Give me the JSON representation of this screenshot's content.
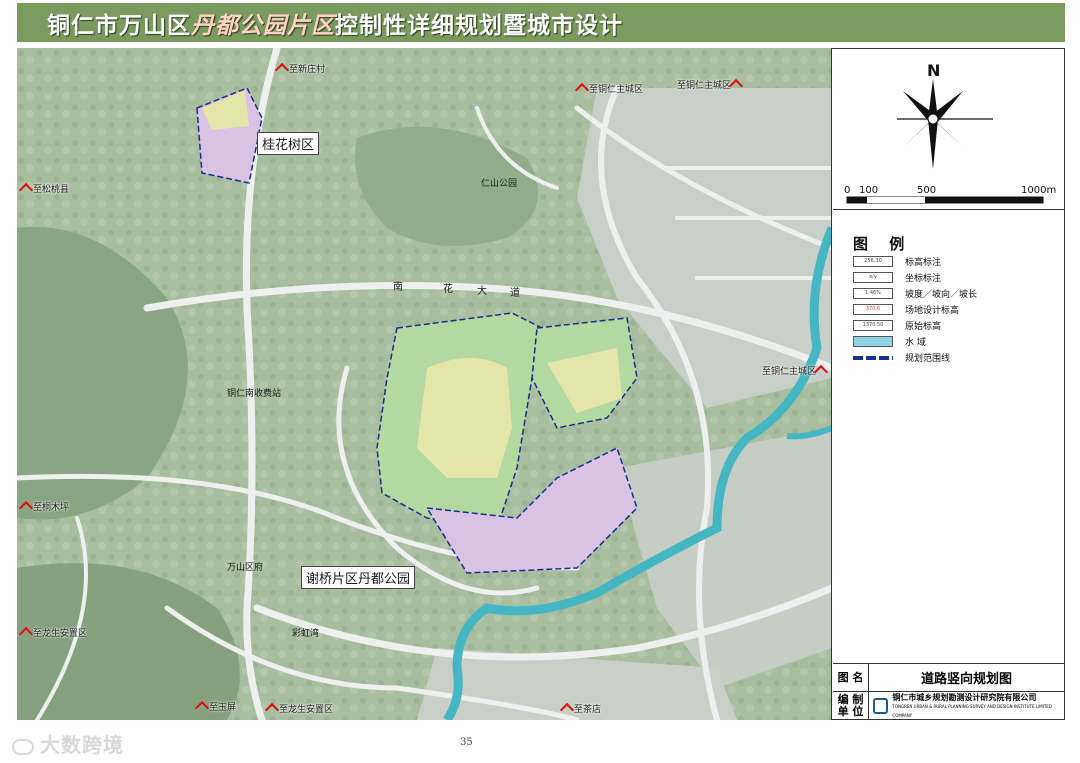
{
  "header": {
    "title_pre": "铜仁市万山区",
    "title_highlight": "丹都公园片区",
    "title_post": "控制性详细规划暨城市设计"
  },
  "map": {
    "area_labels": {
      "guihuashu": "桂花树区",
      "xieqiao": "谢桥片区丹都公园",
      "renshan_park": "仁山公园",
      "toll_station": "铜仁南收费站",
      "wanshan": "万山区府",
      "caihong": "彩虹湾"
    },
    "road_label": [
      "南",
      "花",
      "大",
      "道"
    ],
    "destinations": [
      "至新庄村",
      "至铜仁主城区",
      "至铜仁主城区",
      "至松桃县",
      "至铜仁主城区",
      "至桐木坪",
      "至龙生安置区",
      "至玉屏",
      "至龙生安置区",
      "至茶店"
    ],
    "colors": {
      "terrain": "#a9bea1",
      "forest": "#7f9a78",
      "road": "#e9ecec",
      "plan_green": "#b3d8a0",
      "plan_yellow": "#e3e6a8",
      "plan_purple": "#d9c3e2",
      "water": "#46b7c2",
      "boundary": "#1d2e8c"
    }
  },
  "compass": {
    "north_label": "N"
  },
  "scale": {
    "ticks": [
      "0",
      "100",
      "500",
      "1000m"
    ]
  },
  "legend": {
    "title": "图 例",
    "items": [
      {
        "sample": "256.30",
        "label": "标高标注"
      },
      {
        "sample": "x/y",
        "label": "坐标标注"
      },
      {
        "sample": "1.46%",
        "label": "坡度／坡向／坡长"
      },
      {
        "sample": "370.6",
        "label": "场地设计标高"
      },
      {
        "sample": "1370.50",
        "label": "原始标高"
      },
      {
        "sample": "",
        "label": "水  域"
      },
      {
        "sample": "",
        "label": "规划范围线"
      }
    ]
  },
  "titlebox": {
    "name_key": "图 名",
    "name_value": "道路竖向规划图",
    "unit_key": "编 制\n单 位",
    "unit_value": "铜仁市城乡规划勘测设计研究院有限公司",
    "unit_en": "TONGREN URBAN & RURAL PLANNING SURVEY AND DESIGN INSTITUTE LIMITED COMPANY"
  },
  "page_number": "35",
  "watermark": "大数跨境"
}
